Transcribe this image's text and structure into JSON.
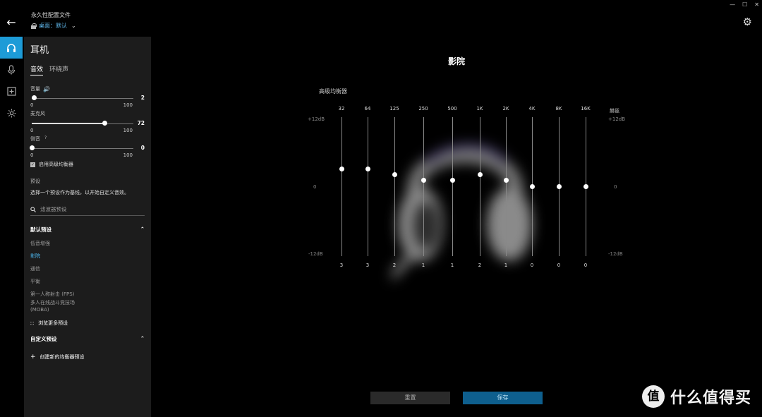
{
  "header": {
    "back_icon": "arrow-left-icon",
    "profile_title": "永久性配置文件",
    "profile_selector": "桌面：默认",
    "window_controls": [
      "—",
      "☐",
      "✕"
    ]
  },
  "rail": [
    "headphones-icon",
    "microphone-icon",
    "plus-box-icon",
    "sun-icon"
  ],
  "panel": {
    "title": "耳机",
    "tabs": [
      "音效",
      "环绕声"
    ],
    "volume": {
      "label": "音量",
      "value": "2",
      "min": "0",
      "max": "100",
      "level": 2
    },
    "mic": {
      "label": "麦克风",
      "value": "72",
      "min": "0",
      "max": "100",
      "level": 72
    },
    "sidetone": {
      "label": "侧音",
      "help": "?",
      "value": "0",
      "min": "0",
      "max": "100",
      "level": 0
    },
    "advanced_eq": "启用高级均衡器",
    "presets_label": "预设",
    "presets_desc": "选择一个预设作为基线，以开始自定义音效。",
    "filter_placeholder": "滤波器预设",
    "default_presets": "默认预设",
    "preset_items": [
      "低音增强",
      "影院",
      "通信",
      "平衡",
      "第一人称射击 (FPS)",
      "多人在线战斗竞技场",
      "(MOBA)"
    ],
    "browse_more": "浏览更多预设",
    "custom_presets": "自定义预设",
    "create_new": "创建新的均衡器预设"
  },
  "eq": {
    "title": "影院",
    "label": "高级均衡器",
    "db_top": "+12dB",
    "db_mid": "0",
    "db_bot": "-12dB",
    "hz": "赫兹",
    "bands": [
      {
        "f": "32",
        "v": "3",
        "g": 3
      },
      {
        "f": "64",
        "v": "3",
        "g": 3
      },
      {
        "f": "125",
        "v": "2",
        "g": 2
      },
      {
        "f": "250",
        "v": "1",
        "g": 1
      },
      {
        "f": "500",
        "v": "1",
        "g": 1
      },
      {
        "f": "1K",
        "v": "2",
        "g": 2
      },
      {
        "f": "2K",
        "v": "1",
        "g": 1
      },
      {
        "f": "4K",
        "v": "0",
        "g": 0
      },
      {
        "f": "8K",
        "v": "0",
        "g": 0
      },
      {
        "f": "16K",
        "v": "0",
        "g": 0
      }
    ],
    "reset": "重置",
    "save": "保存"
  },
  "watermark": {
    "logo": "值",
    "text": "什么值得买"
  }
}
